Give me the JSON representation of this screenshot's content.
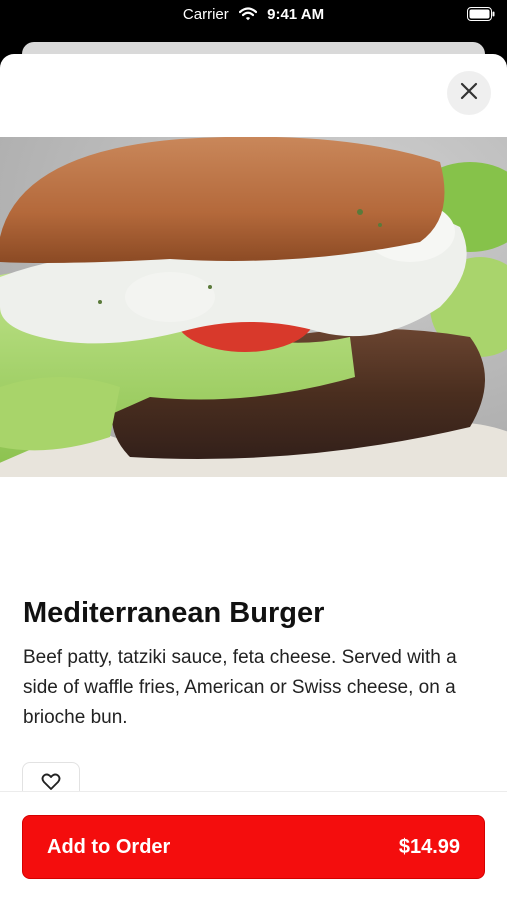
{
  "status_bar": {
    "carrier": "Carrier",
    "time": "9:41 AM"
  },
  "item": {
    "title": "Mediterranean Burger",
    "description": "Beef patty, tatziki sauce, feta cheese. Served with a side of waffle fries, American or Swiss cheese, on a brioche bun."
  },
  "order_button": {
    "label": "Add to Order",
    "price": "$14.99"
  },
  "colors": {
    "accent": "#f40d0d",
    "sheet_background": "#ffffff",
    "status_bar_background": "#000000"
  },
  "icons": {
    "close": "close-icon",
    "favorite": "heart-icon",
    "wifi": "wifi-icon",
    "battery": "battery-icon"
  }
}
